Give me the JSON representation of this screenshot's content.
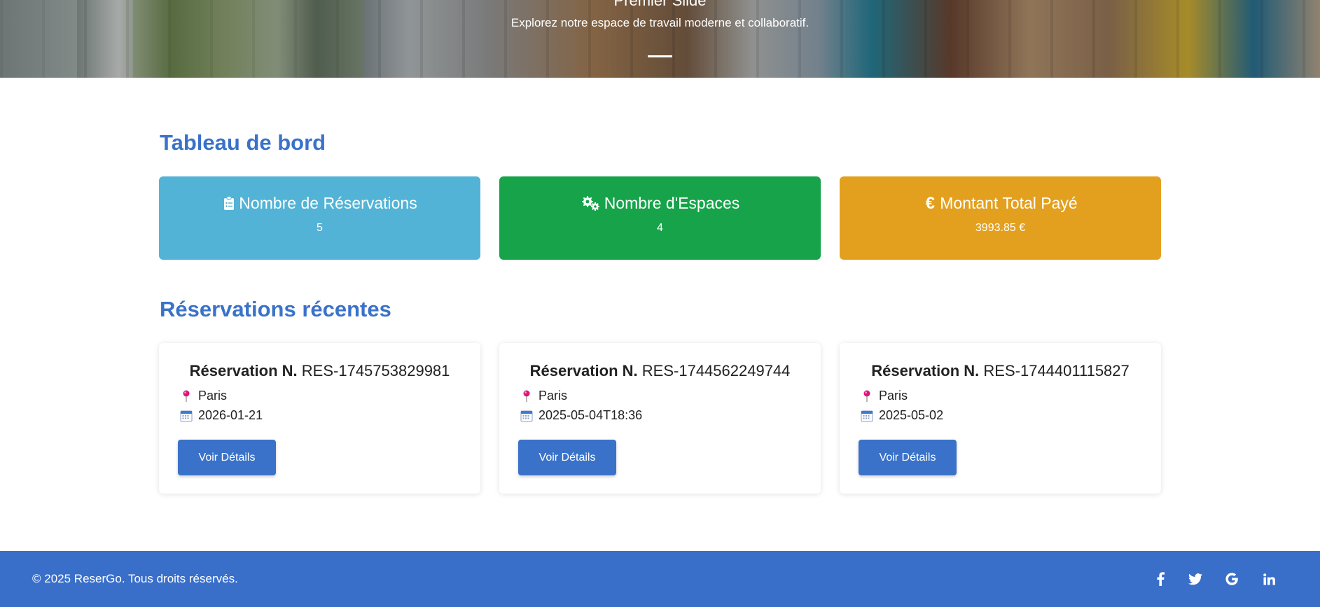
{
  "hero": {
    "slide_title": "Premier Slide",
    "slide_subtitle": "Explorez notre espace de travail moderne et collaboratif."
  },
  "dashboard": {
    "title": "Tableau de bord",
    "stats": [
      {
        "label": "Nombre de Réservations",
        "value": "5",
        "icon": "clipboard-list-icon",
        "color": "#52b3d6"
      },
      {
        "label": "Nombre d'Espaces",
        "value": "4",
        "icon": "gears-icon",
        "color": "#16a34a"
      },
      {
        "label": "Montant Total Payé",
        "value": "3993.85 €",
        "icon": "euro-icon",
        "color": "#e3a01e"
      }
    ]
  },
  "recent": {
    "title": "Réservations récentes",
    "label_prefix": "Réservation N.",
    "button_label": "Voir Détails",
    "items": [
      {
        "number": "RES-1745753829981",
        "city": "Paris",
        "date": "2026-01-21"
      },
      {
        "number": "RES-1744562249744",
        "city": "Paris",
        "date": "2025-05-04T18:36"
      },
      {
        "number": "RES-1744401115827",
        "city": "Paris",
        "date": "2025-05-02"
      }
    ]
  },
  "footer": {
    "copyright": "© 2025 ReserGo. Tous droits réservés.",
    "social": [
      "facebook-icon",
      "twitter-icon",
      "google-icon",
      "linkedin-icon"
    ],
    "color": "#3a6fc9"
  }
}
